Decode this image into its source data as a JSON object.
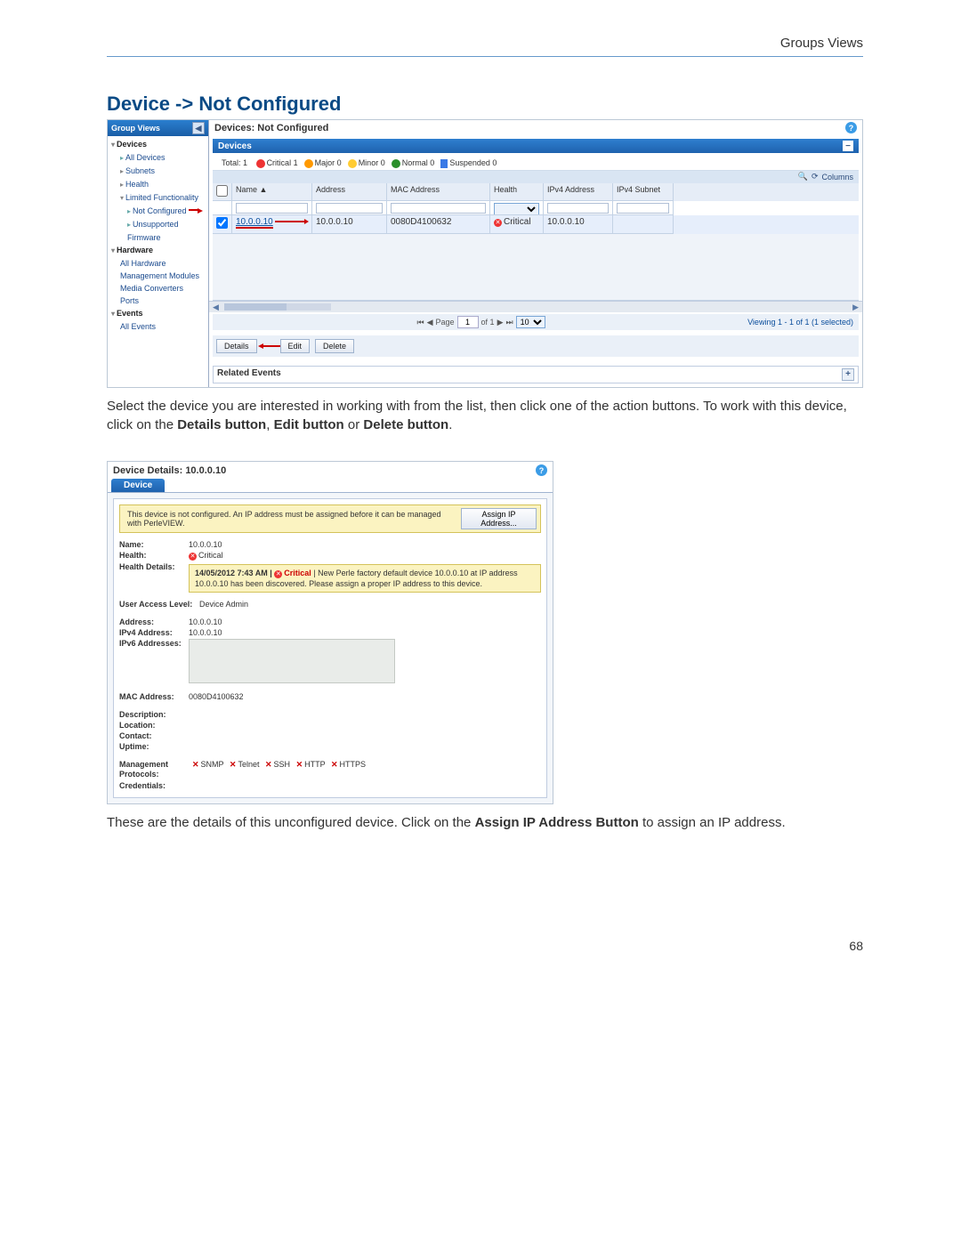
{
  "header": {
    "breadcrumb": "Groups Views"
  },
  "heading": "Device -> Not Configured",
  "sidebar": {
    "title": "Group Views",
    "devices": {
      "label": "Devices",
      "all": "All Devices",
      "subnets": "Subnets",
      "health": "Health",
      "limited": "Limited Functionality",
      "not_configured": "Not Configured",
      "unsupported": "Unsupported Firmware"
    },
    "hardware": {
      "label": "Hardware",
      "all": "All Hardware",
      "mgmt": "Management Modules",
      "media": "Media Converters",
      "ports": "Ports"
    },
    "events": {
      "label": "Events",
      "all": "All Events"
    }
  },
  "main": {
    "title": "Devices: Not Configured",
    "panel": "Devices",
    "summary": {
      "total_label": "Total:",
      "total": "1",
      "critical_label": "Critical",
      "critical": "1",
      "major_label": "Major",
      "major": "0",
      "minor_label": "Minor",
      "minor": "0",
      "normal_label": "Normal",
      "normal": "0",
      "suspended_label": "Suspended",
      "suspended": "0"
    },
    "columns_tool": "Columns",
    "cols": {
      "name": "Name ▲",
      "address": "Address",
      "mac": "MAC Address",
      "health": "Health",
      "ipv4addr": "IPv4 Address",
      "ipv4sub": "IPv4 Subnet"
    },
    "row": {
      "name": "10.0.0.10",
      "address": "10.0.0.10",
      "mac": "0080D4100632",
      "health": "Critical",
      "ipv4addr": "10.0.0.10"
    },
    "pager": {
      "page_label": "Page",
      "page": "1",
      "of": "of 1",
      "per_page": "10",
      "viewing": "Viewing 1 - 1 of 1 (1 selected)"
    },
    "buttons": {
      "details": "Details",
      "edit": "Edit",
      "delete": "Delete"
    },
    "related": "Related Events"
  },
  "para1": {
    "t1": "Select the device you are interested in working with from the list, then click one of the action buttons. To work with this device, click on the ",
    "b1": "Details button",
    "sep1": ", ",
    "b2": "Edit button",
    "sep2": " or ",
    "b3": "Delete button",
    "end": "."
  },
  "details": {
    "title": "Device Details: 10.0.0.10",
    "tab": "Device",
    "warning": "This device is not configured. An IP address must be assigned before it can be managed with PerleVIEW.",
    "assign_btn": "Assign IP Address...",
    "name_l": "Name:",
    "name_v": "10.0.0.10",
    "health_l": "Health:",
    "health_v": "Critical",
    "hdet_l": "Health Details:",
    "hdet_msg_pre": "14/05/2012 7:43 AM | ",
    "hdet_msg_crit": "Critical",
    "hdet_msg_post": " | New Perle factory default device 10.0.0.10 at IP address 10.0.0.10 has been discovered. Please assign a proper IP address to this device.",
    "access_l": "User Access Level:",
    "access_v": "Device Admin",
    "addr_l": "Address:",
    "addr_v": "10.0.0.10",
    "ipv4_l": "IPv4 Address:",
    "ipv4_v": "10.0.0.10",
    "ipv6_l": "IPv6 Addresses:",
    "mac_l": "MAC Address:",
    "mac_v": "0080D4100632",
    "desc_l": "Description:",
    "loc_l": "Location:",
    "contact_l": "Contact:",
    "uptime_l": "Uptime:",
    "proto_l": "Management Protocols:",
    "protos": {
      "snmp": "SNMP",
      "telnet": "Telnet",
      "ssh": "SSH",
      "http": "HTTP",
      "https": "HTTPS"
    },
    "cred_l": "Credentials:"
  },
  "para2": {
    "t1": "These are the details of this unconfigured device. Click on the ",
    "b1": "Assign IP Address Button",
    "t2": " to assign an IP address."
  },
  "page_number": "68"
}
